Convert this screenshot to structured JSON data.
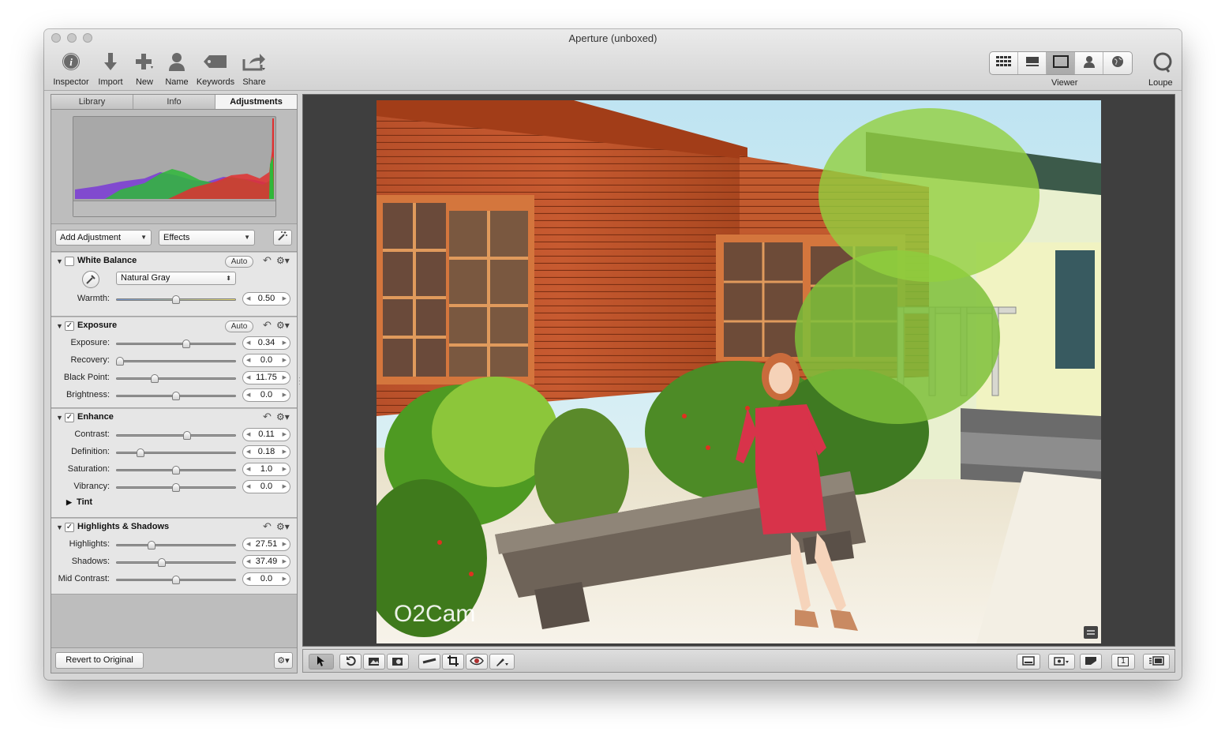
{
  "window": {
    "title": "Aperture (unboxed)"
  },
  "toolbar": {
    "items": [
      {
        "label": "Inspector",
        "icon": "info-icon"
      },
      {
        "label": "Import",
        "icon": "download-arrow-icon"
      },
      {
        "label": "New",
        "icon": "plus-icon"
      },
      {
        "label": "Name",
        "icon": "person-icon"
      },
      {
        "label": "Keywords",
        "icon": "tag-icon"
      },
      {
        "label": "Share",
        "icon": "share-icon"
      }
    ],
    "viewer_label": "Viewer",
    "loupe_label": "Loupe"
  },
  "inspector": {
    "tabs": [
      "Library",
      "Info",
      "Adjustments"
    ],
    "active_tab": "Adjustments",
    "add_adjustment": "Add Adjustment",
    "effects": "Effects",
    "footer": {
      "revert": "Revert to Original"
    }
  },
  "white_balance": {
    "title": "White Balance",
    "enabled": false,
    "auto": "Auto",
    "mode": "Natural Gray",
    "warmth_label": "Warmth:",
    "warmth_value": "0.50",
    "warmth_fraction": 0.5
  },
  "exposure": {
    "title": "Exposure",
    "enabled": true,
    "auto": "Auto",
    "sliders": [
      {
        "label": "Exposure:",
        "value": "0.34",
        "pos": 0.59
      },
      {
        "label": "Recovery:",
        "value": "0.0",
        "pos": 0.0
      },
      {
        "label": "Black Point:",
        "value": "11.75",
        "pos": 0.31
      },
      {
        "label": "Brightness:",
        "value": "0.0",
        "pos": 0.5
      }
    ]
  },
  "enhance": {
    "title": "Enhance",
    "enabled": true,
    "sliders": [
      {
        "label": "Contrast:",
        "value": "0.11",
        "pos": 0.6
      },
      {
        "label": "Definition:",
        "value": "0.18",
        "pos": 0.18
      },
      {
        "label": "Saturation:",
        "value": "1.0",
        "pos": 0.5
      },
      {
        "label": "Vibrancy:",
        "value": "0.0",
        "pos": 0.5
      }
    ],
    "tint": "Tint"
  },
  "highlights_shadows": {
    "title": "Highlights & Shadows",
    "enabled": true,
    "sliders": [
      {
        "label": "Highlights:",
        "value": "27.51",
        "pos": 0.28
      },
      {
        "label": "Shadows:",
        "value": "37.49",
        "pos": 0.37
      },
      {
        "label": "Mid Contrast:",
        "value": "0.0",
        "pos": 0.5
      }
    ]
  },
  "photo": {
    "watermark": "O2Cam"
  }
}
